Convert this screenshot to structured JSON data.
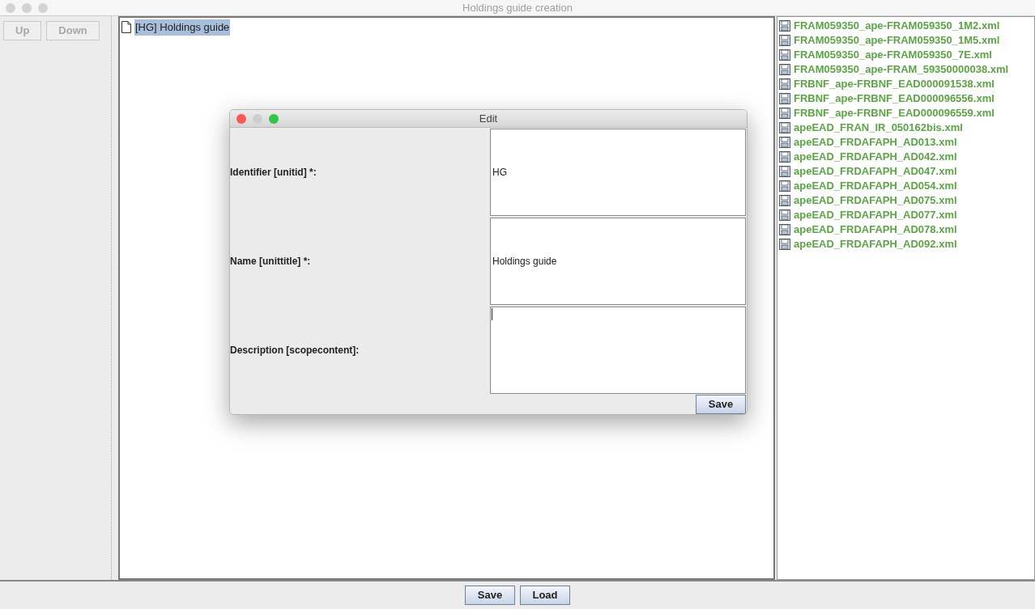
{
  "window": {
    "title": "Holdings guide creation"
  },
  "order_buttons": [
    {
      "label": "Up",
      "disabled": true
    },
    {
      "label": "Down",
      "disabled": true
    }
  ],
  "tree": {
    "items": [
      {
        "label": "[HG] Holdings guide",
        "selected": true
      }
    ]
  },
  "files": [
    "FRAM059350_ape-FRAM059350_1M2.xml",
    "FRAM059350_ape-FRAM059350_1M5.xml",
    "FRAM059350_ape-FRAM059350_7E.xml",
    "FRAM059350_ape-FRAM_59350000038.xml",
    "FRBNF_ape-FRBNF_EAD000091538.xml",
    "FRBNF_ape-FRBNF_EAD000096556.xml",
    "FRBNF_ape-FRBNF_EAD000096559.xml",
    "apeEAD_FRAN_IR_050162bis.xml",
    "apeEAD_FRDAFAPH_AD013.xml",
    "apeEAD_FRDAFAPH_AD042.xml",
    "apeEAD_FRDAFAPH_AD047.xml",
    "apeEAD_FRDAFAPH_AD054.xml",
    "apeEAD_FRDAFAPH_AD075.xml",
    "apeEAD_FRDAFAPH_AD077.xml",
    "apeEAD_FRDAFAPH_AD078.xml",
    "apeEAD_FRDAFAPH_AD092.xml"
  ],
  "bottom_buttons": [
    "Save",
    "Load"
  ],
  "dialog": {
    "title": "Edit",
    "fields": [
      {
        "label": "Identifier [unitid] *:",
        "value": "HG",
        "focused": false
      },
      {
        "label": "Name [unittitle] *:",
        "value": "Holdings guide",
        "focused": false
      },
      {
        "label": "Description [scopecontent]:",
        "focused": true
      }
    ],
    "button": "Save"
  }
}
